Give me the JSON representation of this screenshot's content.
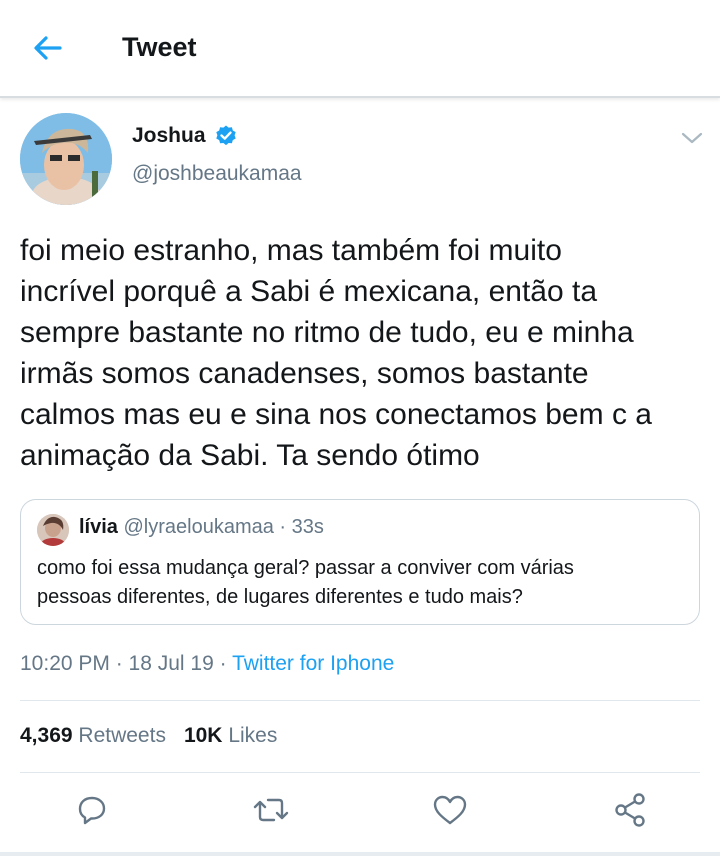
{
  "header": {
    "title": "Tweet",
    "back_icon": "arrow-left-icon",
    "accent": "#1da1f2"
  },
  "tweet": {
    "author": {
      "name": "Joshua",
      "handle": "@joshbeaukamaa",
      "verified": true
    },
    "text_lines": [
      "foi meio estranho, mas também foi muito",
      "incrível porquê a Sabi é mexicana, então ta",
      "sempre bastante no ritmo de tudo, eu e minha",
      "irmãs somos canadenses, somos bastante",
      "calmos mas eu e sina nos conectamos bem c a",
      "animação da Sabi. Ta sendo ótimo"
    ],
    "quoted": {
      "name": "lívia",
      "meta": "@lyraeloukamaa · 33s",
      "text_lines": [
        "como foi essa mudança geral? passar a conviver com várias",
        "pessoas diferentes, de lugares diferentes e tudo mais?"
      ]
    },
    "timestamp": "10:20 PM · 18 Jul 19 · ",
    "client": "Twitter for Iphone",
    "stats": {
      "retweets_count": "4,369",
      "retweets_label": "Retweets",
      "likes_count": "10K",
      "likes_label": "Likes"
    }
  },
  "actions": [
    "reply-icon",
    "retweet-icon",
    "like-icon",
    "share-icon"
  ],
  "colors": {
    "text": "#14171a",
    "secondary": "#657786",
    "link": "#1da1f2",
    "border": "#ccd6dd"
  }
}
